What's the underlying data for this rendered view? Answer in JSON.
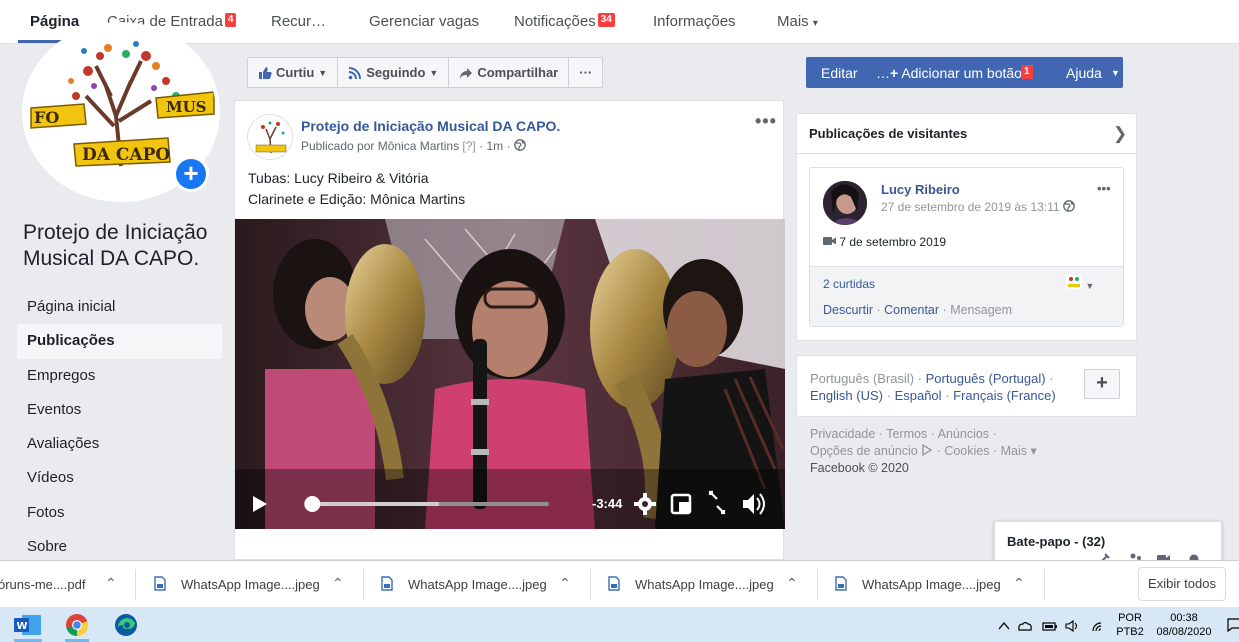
{
  "topnav": {
    "tabs": [
      {
        "label": "Página",
        "badge": ""
      },
      {
        "label": "Caixa de Entrada",
        "badge": "4"
      },
      {
        "label": "Recur…",
        "badge": ""
      },
      {
        "label": "Gerenciar vagas",
        "badge": ""
      },
      {
        "label": "Notificações",
        "badge": "34"
      },
      {
        "label": "Informações",
        "badge": ""
      },
      {
        "label": "Mais",
        "badge": ""
      }
    ],
    "more_caret": "▾"
  },
  "page": {
    "name": "Protejo de Iniciação Musical DA CAPO."
  },
  "leftnav": {
    "items": [
      "Página inicial",
      "Publicações",
      "Empregos",
      "Eventos",
      "Avaliações",
      "Vídeos",
      "Fotos",
      "Sobre"
    ],
    "active": "Publicações"
  },
  "actions": {
    "like": "Curtiu",
    "follow": "Seguindo",
    "share": "Compartilhar",
    "more": "···"
  },
  "bluebar": {
    "edit": "Editar",
    "add_button": "Adicionar um botão",
    "help": "Ajuda",
    "badge": "1"
  },
  "post": {
    "page_name": "Protejo de Iniciação Musical DA CAPO.",
    "published_by": "Publicado por Mônica Martins",
    "help_mark": "[?]",
    "time": "· 1m ·",
    "line1": "Tubas: Lucy Ribeiro & Vitória",
    "line2": "Clarinete e Edição: Mônica Martins",
    "video": {
      "time_remaining": "-3:44",
      "progress": 0.03,
      "buffered": 0.55
    }
  },
  "visitor_posts": {
    "title": "Publicações de visitantes",
    "author": "Lucy Ribeiro",
    "date": "27 de setembro de 2019 às 13:11",
    "video_date": "7 de setembro 2019",
    "likes": "2 curtidas",
    "unlike": "Descurtir",
    "comment": "Comentar",
    "message": "Mensagem"
  },
  "languages": {
    "current": "Português (Brasil)",
    "items": [
      "Português (Portugal)",
      "English (US)",
      "Español",
      "Français (France)"
    ]
  },
  "footer": {
    "links": [
      "Privacidade",
      "Termos",
      "Anúncios",
      "Opções de anúncio",
      "Cookies",
      "Mais"
    ],
    "copyright": "Facebook © 2020"
  },
  "chat": {
    "label": "Bate-papo - (32)"
  },
  "downloads": {
    "items": [
      "óruns-me....pdf",
      "WhatsApp Image....jpeg",
      "WhatsApp Image....jpeg",
      "WhatsApp Image....jpeg",
      "WhatsApp Image....jpeg"
    ],
    "show_all": "Exibir todos"
  },
  "taskbar": {
    "lang": "POR",
    "layout": "PTB2",
    "time": "00:38",
    "date": "08/08/2020"
  },
  "colors": {
    "facebook_blue": "#4267b2",
    "link": "#385898",
    "badge_red": "#fa3e3e"
  }
}
